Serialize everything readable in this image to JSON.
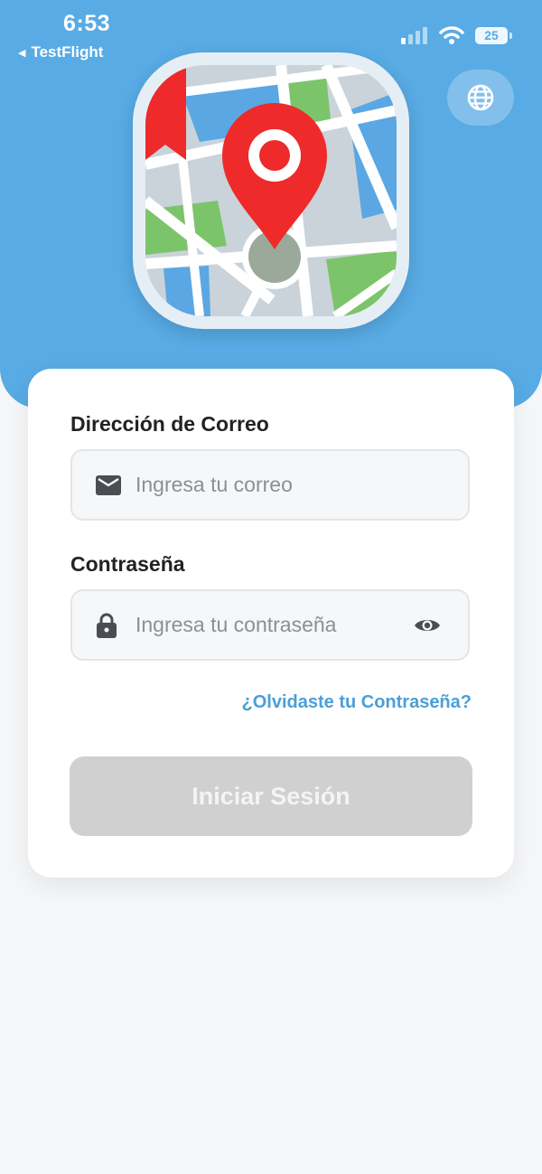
{
  "status_bar": {
    "time": "6:53",
    "back_app": "TestFlight",
    "battery": "25"
  },
  "header": {
    "language_button_icon": "globe-icon",
    "app_icon": "map-pin-icon"
  },
  "form": {
    "email_label": "Dirección de Correo",
    "email_placeholder": "Ingresa tu correo",
    "email_icon": "mail-icon",
    "password_label": "Contraseña",
    "password_placeholder": "Ingresa tu contraseña",
    "password_icon": "lock-icon",
    "toggle_icon": "eye-icon",
    "forgot_link": "¿Olvidaste tu Contraseña?",
    "submit_label": "Iniciar Sesión"
  },
  "colors": {
    "header_bg": "#58abe5",
    "link": "#4a9fd8",
    "button_disabled": "#d0d0d0",
    "pin_red": "#ee2a2a"
  }
}
